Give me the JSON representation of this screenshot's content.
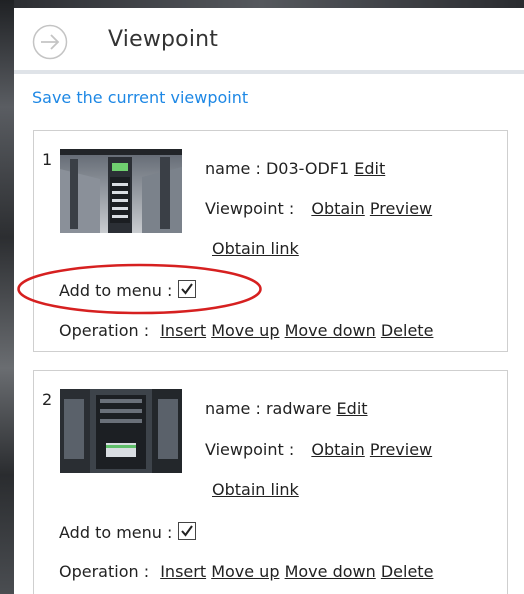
{
  "header": {
    "title": "Viewpoint",
    "back_icon": "arrow-right-circle-icon"
  },
  "save_link": "Save the current viewpoint",
  "labels": {
    "name": "name :",
    "viewpoint": "Viewpoint :",
    "add_to_menu": "Add to menu :",
    "operation": "Operation :",
    "edit": "Edit",
    "obtain": "Obtain",
    "preview": "Preview",
    "obtain_link": "Obtain link",
    "insert": "Insert",
    "move_up": "Move up",
    "move_down": "Move down",
    "delete": "Delete"
  },
  "viewpoints": [
    {
      "index": "1",
      "name": "D03-ODF1",
      "add_to_menu": true,
      "highlighted": true
    },
    {
      "index": "2",
      "name": "radware",
      "add_to_menu": true,
      "highlighted": false
    }
  ],
  "colors": {
    "link": "#1e88e5",
    "highlight": "#d62020",
    "header_border": "#dfe3e8"
  }
}
